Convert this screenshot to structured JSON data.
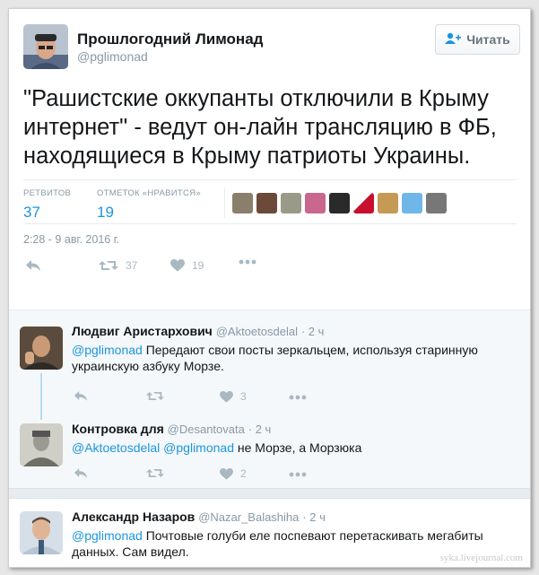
{
  "tweet": {
    "author_name": "Прошлогодний Лимонад",
    "author_handle": "@pglimonad",
    "follow_label": "Читать",
    "text": "\"Рашистские оккупанты отключили в Крыму интернет\" - ведут он-лайн трансляцию в ФБ, находящиеся в Крыму патриоты Украины.",
    "retweets_label": "РЕТВИТОВ",
    "retweets_count": "37",
    "likes_label": "ОТМЕТОК «НРАВИТСЯ»",
    "likes_count": "19",
    "timestamp": "2:28 - 9 авг. 2016 г.",
    "action_retweet_count": "37",
    "action_like_count": "19"
  },
  "replies": [
    {
      "name": "Людвиг Аристархович",
      "handle": "@Aktoetosdelal",
      "time": "· 2 ч",
      "mention": "@pglimonad",
      "text": " Передают свои посты зеркальцем, используя старинную украинскую азбуку Морзе.",
      "like_count": "3"
    },
    {
      "name": "Контровка для",
      "handle": "@Desantovata",
      "time": "· 2 ч",
      "mention1": "@Aktoetosdelal",
      "mention2": "@pglimonad",
      "text": " не Морзе, а Морзюка",
      "like_count": "2"
    },
    {
      "name": "Александр Назаров",
      "handle": "@Nazar_Balashiha",
      "time": "· 2 ч",
      "mention": "@pglimonad",
      "text": " Почтовые голуби еле поспевают перетаскивать мегабиты данных. Сам видел."
    }
  ],
  "watermark": "syka.livejournal.com",
  "colors": {
    "link": "#1b95e0",
    "muted": "#8899a6",
    "icon": "#aab8c2"
  },
  "icons": [
    "person-plus-icon",
    "reply-icon",
    "retweet-icon",
    "heart-icon",
    "more-icon"
  ]
}
